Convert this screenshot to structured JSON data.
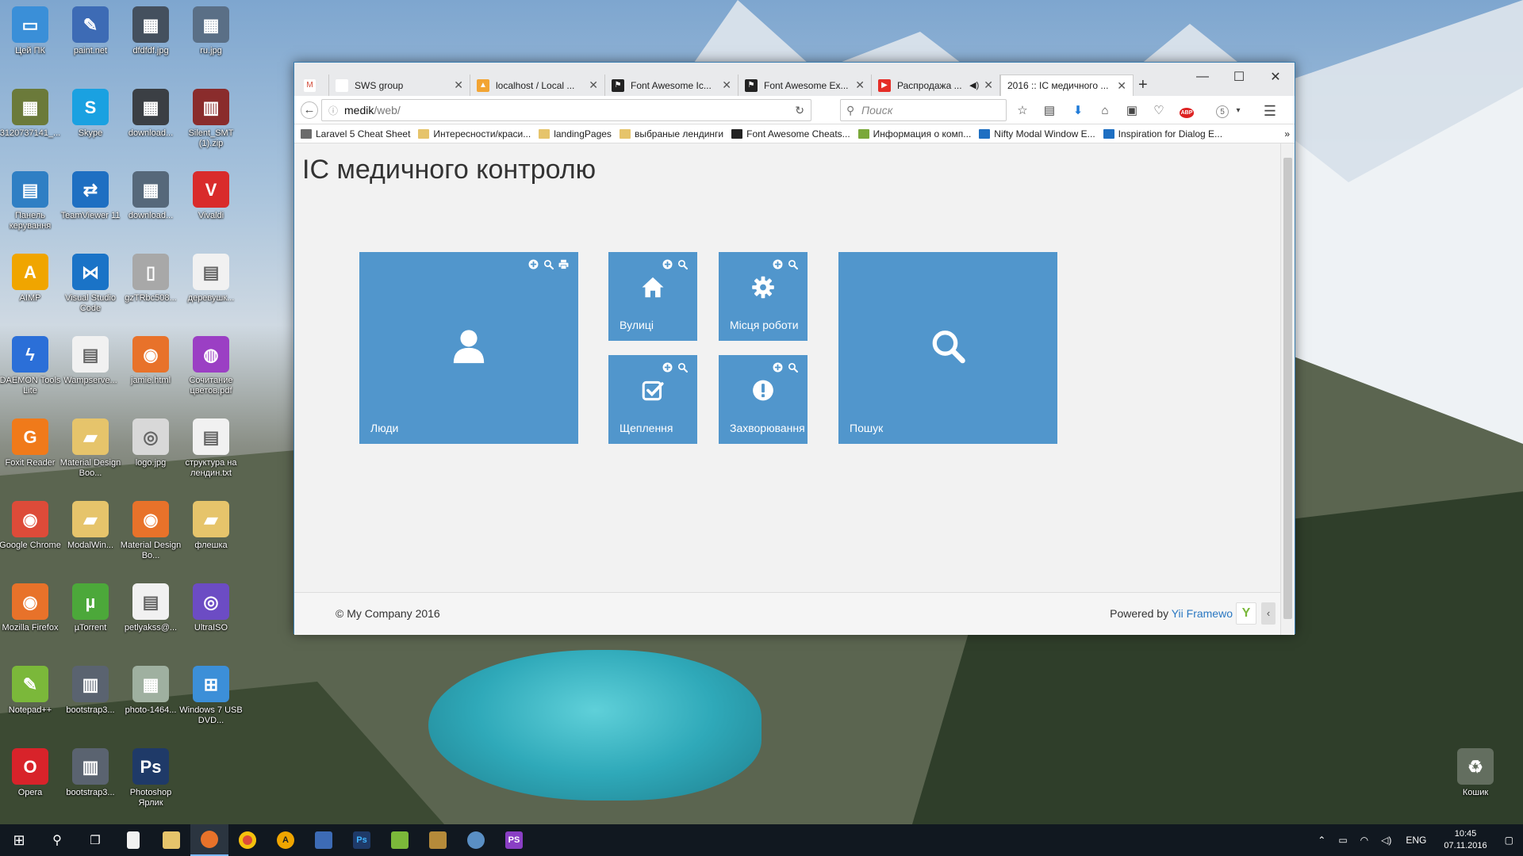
{
  "desktop": {
    "icons": [
      {
        "label": "Цей ПК",
        "color": "#3a8fd8",
        "glyph": "▭"
      },
      {
        "label": "paint.net",
        "color": "#3d6bb5",
        "glyph": "✎"
      },
      {
        "label": "dfdfdf.jpg",
        "color": "#44505e",
        "glyph": "▦"
      },
      {
        "label": "ru.jpg",
        "color": "#5a6f86",
        "glyph": "▦"
      },
      {
        "label": "3120737141_...",
        "color": "#6b7a3a",
        "glyph": "▦"
      },
      {
        "label": "Skype",
        "color": "#1aa1e1",
        "glyph": "S"
      },
      {
        "label": "download...",
        "color": "#3b3f44",
        "glyph": "▦"
      },
      {
        "label": "Silent_SMT (1).zip",
        "color": "#8a2c2c",
        "glyph": "▥"
      },
      {
        "label": "Панель керування",
        "color": "#2f7fc4",
        "glyph": "▤"
      },
      {
        "label": "TeamViewer 11",
        "color": "#1e6fc2",
        "glyph": "⇄"
      },
      {
        "label": "download...",
        "color": "#56687a",
        "glyph": "▦"
      },
      {
        "label": "Vivaldi",
        "color": "#d92b2b",
        "glyph": "V"
      },
      {
        "label": "AIMP",
        "color": "#f0a500",
        "glyph": "A"
      },
      {
        "label": "Visual Studio Code",
        "color": "#1a73c7",
        "glyph": "⋈"
      },
      {
        "label": "gzTRbc508...",
        "color": "#a8a8a8",
        "glyph": "▯"
      },
      {
        "label": "деревушк...",
        "color": "#f1f1f1",
        "glyph": "▤"
      },
      {
        "label": "DAEMON Tools Lite",
        "color": "#2b6fd8",
        "glyph": "ϟ"
      },
      {
        "label": "Wampserve...",
        "color": "#f1f1f1",
        "glyph": "▤"
      },
      {
        "label": "jamie.html",
        "color": "#e8722a",
        "glyph": "◉"
      },
      {
        "label": "Сочитание цветов.pdf",
        "color": "#9b3fc4",
        "glyph": "◍"
      },
      {
        "label": "Foxit Reader",
        "color": "#f07a1a",
        "glyph": "G"
      },
      {
        "label": "Material Design Boo...",
        "color": "#e6c46b",
        "glyph": "▰"
      },
      {
        "label": "logo.jpg",
        "color": "#d8d8d8",
        "glyph": "◎"
      },
      {
        "label": "структура на лендин.txt",
        "color": "#f1f1f1",
        "glyph": "▤"
      },
      {
        "label": "Google Chrome",
        "color": "#dd4b39",
        "glyph": "◉"
      },
      {
        "label": "ModalWin...",
        "color": "#e6c46b",
        "glyph": "▰"
      },
      {
        "label": "Material Design Bo...",
        "color": "#e8722a",
        "glyph": "◉"
      },
      {
        "label": "флешка",
        "color": "#e6c46b",
        "glyph": "▰"
      },
      {
        "label": "Mozilla Firefox",
        "color": "#e8722a",
        "glyph": "◉"
      },
      {
        "label": "µTorrent",
        "color": "#4ca83a",
        "glyph": "µ"
      },
      {
        "label": "petlyakss@...",
        "color": "#f1f1f1",
        "glyph": "▤"
      },
      {
        "label": "UltraISO",
        "color": "#6c4cc4",
        "glyph": "◎"
      },
      {
        "label": "Notepad++",
        "color": "#7bb83a",
        "glyph": "✎"
      },
      {
        "label": "bootstrap3...",
        "color": "#5a6370",
        "glyph": "▥"
      },
      {
        "label": "photo-1464...",
        "color": "#9fb0a0",
        "glyph": "▦"
      },
      {
        "label": "Windows 7 USB DVD...",
        "color": "#3c8fd8",
        "glyph": "⊞"
      },
      {
        "label": "Opera",
        "color": "#d8232a",
        "glyph": "O"
      },
      {
        "label": "bootstrap3...",
        "color": "#5a6370",
        "glyph": "▥"
      },
      {
        "label": "Photoshop Ярлик",
        "color": "#1f3a68",
        "glyph": "Ps"
      }
    ],
    "recycle_bin": {
      "label": "Кошик",
      "glyph": "♻"
    }
  },
  "browser": {
    "tabs": [
      {
        "title": "",
        "icon_color": "#ffffff",
        "glyph": "M",
        "glyph_color": "#d14836"
      },
      {
        "title": "SWS group",
        "icon_color": "#ffffff",
        "glyph": "",
        "glyph_color": "#000"
      },
      {
        "title": "localhost / Local ...",
        "icon_color": "#f2a433",
        "glyph": "▲",
        "glyph_color": "#fff"
      },
      {
        "title": "Font Awesome Ic...",
        "icon_color": "#222222",
        "glyph": "⚑",
        "glyph_color": "#fff"
      },
      {
        "title": "Font Awesome Ex...",
        "icon_color": "#222222",
        "glyph": "⚑",
        "glyph_color": "#fff"
      },
      {
        "title": "Распродажа ...",
        "icon_color": "#e52d27",
        "glyph": "▶",
        "glyph_color": "#fff"
      },
      {
        "title": "2016 :: ІС медичного ...",
        "icon_color": "",
        "glyph": "",
        "glyph_color": "#000"
      }
    ],
    "new_tab": "+",
    "window_controls": {
      "minimize": "—",
      "maximize": "☐",
      "close": "✕"
    },
    "url": {
      "host": "medik",
      "path": "/web/"
    },
    "search_placeholder": "Поиск",
    "bookmarks": [
      {
        "label": "Laravel 5 Cheat Sheet",
        "color": "#6b6b6b"
      },
      {
        "label": "Интересности/краси...",
        "color": "#e6c46b"
      },
      {
        "label": "landingPages",
        "color": "#e6c46b"
      },
      {
        "label": "выбраные лендинги",
        "color": "#e6c46b"
      },
      {
        "label": "Font Awesome Cheats...",
        "color": "#222222"
      },
      {
        "label": "Информация о комп...",
        "color": "#7aa83a"
      },
      {
        "label": "Nifty Modal Window E...",
        "color": "#1e6fc2"
      },
      {
        "label": "Inspiration for Dialog E...",
        "color": "#1e6fc2"
      }
    ],
    "bookmarks_overflow": "»",
    "addon_badge": "ABP",
    "addon_count": "5"
  },
  "page": {
    "title": "ІС медичного контролю",
    "accent": "#5196cc",
    "tiles": [
      {
        "id": "people",
        "label": "Люди",
        "icon": "user-icon",
        "tools": [
          "plus",
          "search",
          "print"
        ]
      },
      {
        "id": "streets",
        "label": "Вулиці",
        "icon": "home-icon",
        "tools": [
          "plus",
          "search"
        ]
      },
      {
        "id": "workplaces",
        "label": "Місця роботи",
        "icon": "cog-icon",
        "tools": [
          "plus",
          "search"
        ]
      },
      {
        "id": "vaccinations",
        "label": "Щеплення",
        "icon": "check-square-icon",
        "tools": [
          "plus",
          "search"
        ]
      },
      {
        "id": "diseases",
        "label": "Захворювання",
        "icon": "exclamation-circle-icon",
        "tools": [
          "plus",
          "search"
        ]
      },
      {
        "id": "search",
        "label": "Пошук",
        "icon": "search-icon",
        "tools": []
      }
    ],
    "footer": {
      "copyright": "© My Company 2016",
      "powered_prefix": "Powered by ",
      "powered_link": "Yii Framewo"
    }
  },
  "taskbar": {
    "language": "ENG",
    "time": "10:45",
    "date": "07.11.2016"
  }
}
